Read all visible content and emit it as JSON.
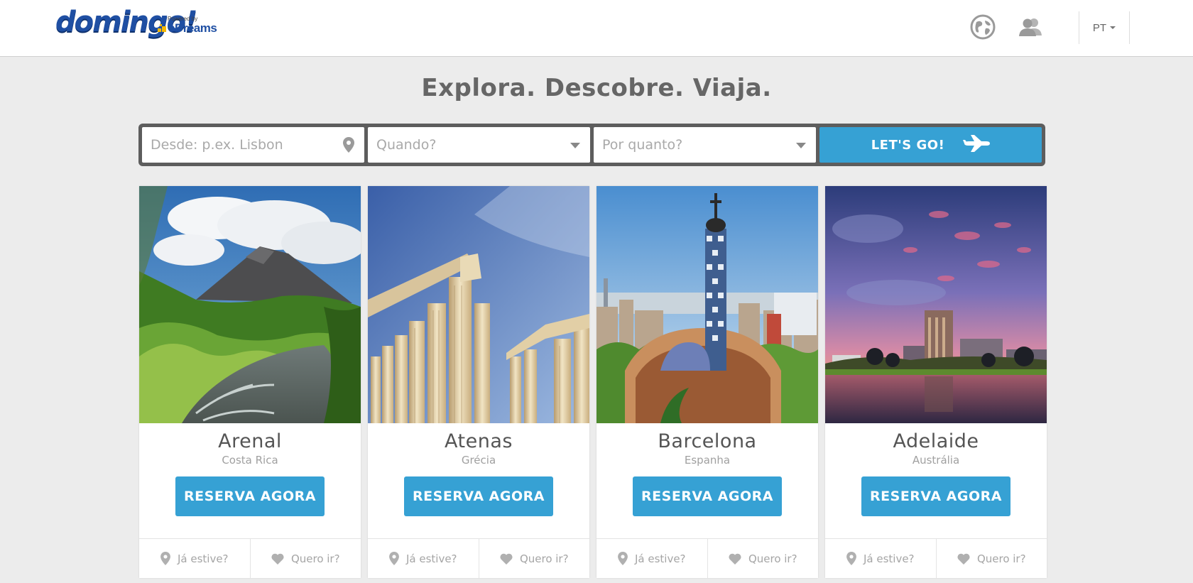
{
  "brand": {
    "logo_text": "domingo!",
    "powered_by": "Powered by",
    "partner": "eDreams",
    "brand_color": "#1f4fa3"
  },
  "header": {
    "language": "PT"
  },
  "hero": {
    "title": "Explora. Descobre. Viaja."
  },
  "search": {
    "from_placeholder": "Desde: p.ex. Lisbon",
    "when_placeholder": "Quando?",
    "budget_placeholder": "Por quanto?",
    "go_label": "LET'S GO!"
  },
  "colors": {
    "accent": "#36a1d4",
    "searchbar_frame": "#5d5d5d",
    "background": "#ececec"
  },
  "cards": [
    {
      "city": "Arenal",
      "country": "Costa Rica",
      "book_label": "RESERVA AGORA",
      "been_label": "Já estive?",
      "want_label": "Quero ir?"
    },
    {
      "city": "Atenas",
      "country": "Grécia",
      "book_label": "RESERVA AGORA",
      "been_label": "Já estive?",
      "want_label": "Quero ir?"
    },
    {
      "city": "Barcelona",
      "country": "Espanha",
      "book_label": "RESERVA AGORA",
      "been_label": "Já estive?",
      "want_label": "Quero ir?"
    },
    {
      "city": "Adelaide",
      "country": "Austrália",
      "book_label": "RESERVA AGORA",
      "been_label": "Já estive?",
      "want_label": "Quero ir?"
    }
  ]
}
